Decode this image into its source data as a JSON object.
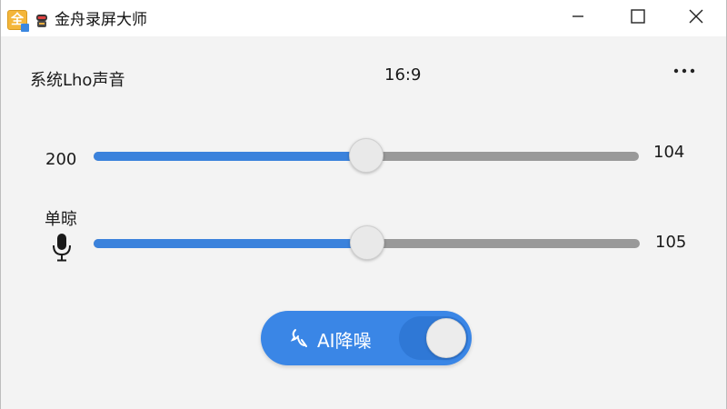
{
  "window": {
    "title": "金舟录屏大师",
    "logo_icon": "app-logo-icon",
    "logo_glyph": "全",
    "secondary_icon": "robot-icon",
    "controls": [
      "minimize-icon",
      "maximize-icon",
      "close-icon"
    ]
  },
  "system_sound": {
    "label": "系统Lho声音",
    "aspect_ratio": "16:9",
    "more_icon": "more-dots-icon",
    "left_value": "200",
    "right_value": "104",
    "level_fraction": 0.5
  },
  "microphone": {
    "label": "单晾",
    "icon": "microphone-icon",
    "right_value": "105",
    "level_fraction": 0.5
  },
  "ai_noise_reduction": {
    "label": "AI降噪",
    "icon": "noise-reduction-icon",
    "enabled": true
  },
  "colors": {
    "accent": "#3b82dc",
    "track": "#999999",
    "toggle_bg": "#3a86e6"
  }
}
